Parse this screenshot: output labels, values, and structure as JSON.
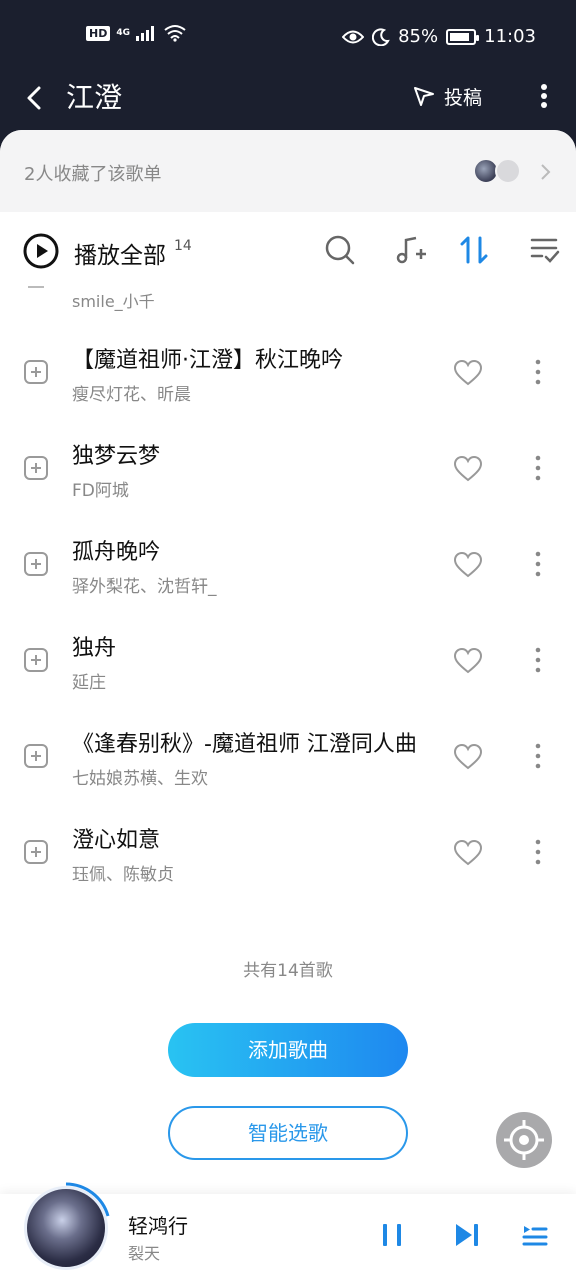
{
  "status_bar": {
    "left_badges": [
      "HD",
      "4G"
    ],
    "battery": "85%",
    "battery_level": 0.85,
    "time": "11:03",
    "icons": [
      "signal-icon",
      "wifi-icon",
      "eye-icon",
      "moon-icon",
      "battery-icon"
    ]
  },
  "header": {
    "title": "江澄",
    "submit_label": "投稿",
    "icons": [
      "back-arrow-icon",
      "send-icon",
      "more-vertical-icon"
    ]
  },
  "favorites": {
    "text": "2人收藏了该歌单"
  },
  "toolbar": {
    "play_all_label": "播放全部",
    "count": "14",
    "icons": [
      "play-circle-icon",
      "search-icon",
      "add-music-icon",
      "sort-icon",
      "multi-select-icon"
    ],
    "accent": "#1e88e5"
  },
  "songs": {
    "partial_artist": "smile_小千",
    "items": [
      {
        "title": "【魔道祖师·江澄】秋江晚吟",
        "artist": "瘦尽灯花、昕晨"
      },
      {
        "title": "独梦云梦",
        "artist": "FD阿城"
      },
      {
        "title": "孤舟晚吟",
        "artist": "驿外梨花、沈哲轩_"
      },
      {
        "title": "独舟",
        "artist": "延庄"
      },
      {
        "title": "《逢春别秋》-魔道祖师 江澄同人曲",
        "artist": "七姑娘苏横、生欢"
      },
      {
        "title": "澄心如意",
        "artist": "珏佩、陈敏贞"
      }
    ]
  },
  "footer": {
    "total": "共有14首歌",
    "add_songs": "添加歌曲",
    "smart_pick": "智能选歌"
  },
  "player": {
    "title": "轻鸿行",
    "artist": "裂天",
    "icons": [
      "pause-icon",
      "next-icon",
      "playlist-icon"
    ]
  }
}
